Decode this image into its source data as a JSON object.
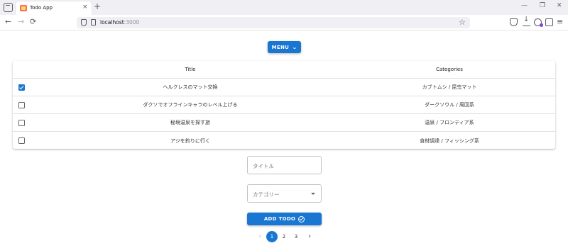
{
  "browser": {
    "tab_title": "Todo App",
    "tab_close": "×",
    "new_tab": "+",
    "url_host": "localhost",
    "url_port": ":3000",
    "back": "←",
    "forward": "→",
    "reload": "⟳",
    "star": "☆",
    "menu": "≡",
    "minimize": "—",
    "restore": "❐",
    "close": "✕"
  },
  "menu_button": {
    "label": "MENU",
    "icon": "chevron-down-icon"
  },
  "table": {
    "headers": {
      "title": "Title",
      "categories": "Categories"
    },
    "rows": [
      {
        "checked": true,
        "title": "ヘルクレスのマット交換",
        "categories": "カブトムシ / 昆虫マット"
      },
      {
        "checked": false,
        "title": "ダクソでオフラインキャラのレベル上げる",
        "categories": "ダークソウル / 周回系"
      },
      {
        "checked": false,
        "title": "秘境温泉を探す旅",
        "categories": "温泉 / フロンティア系"
      },
      {
        "checked": false,
        "title": "アジを釣りに行く",
        "categories": "食材調達 / フィッシング系"
      }
    ]
  },
  "form": {
    "title_placeholder": "タイトル",
    "category_placeholder": "カテゴリー",
    "add_button_label": "ADD TODO"
  },
  "pagination": {
    "prev": "‹",
    "next": "›",
    "pages": [
      "1",
      "2",
      "3"
    ],
    "current": "1"
  },
  "colors": {
    "primary": "#1976d2"
  }
}
